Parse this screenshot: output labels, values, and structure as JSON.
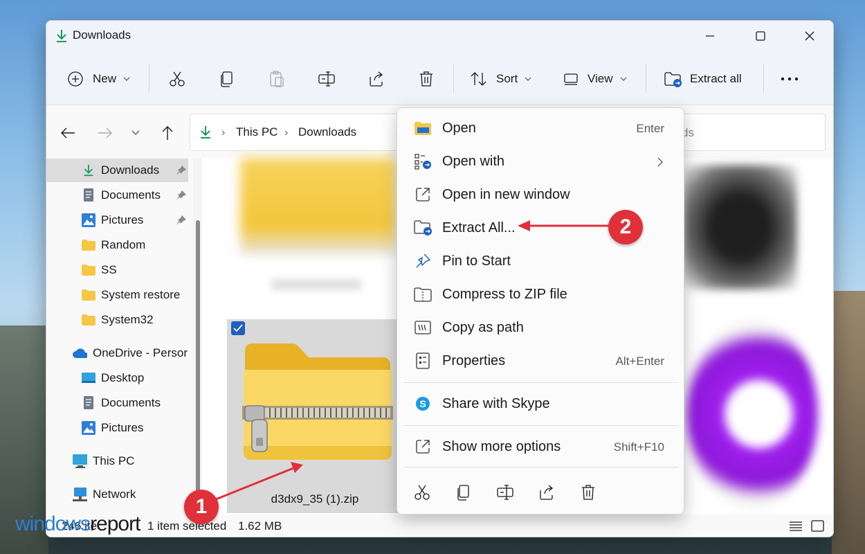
{
  "window": {
    "title": "Downloads"
  },
  "toolbar": {
    "new_label": "New",
    "sort_label": "Sort",
    "view_label": "View",
    "extract_label": "Extract all"
  },
  "address": {
    "crumbs": [
      "This PC",
      "Downloads"
    ],
    "search_placeholder": "ds"
  },
  "sidebar": {
    "items": [
      {
        "label": "Downloads",
        "icon": "download-icon",
        "pinned": true
      },
      {
        "label": "Documents",
        "icon": "document-icon",
        "pinned": true
      },
      {
        "label": "Pictures",
        "icon": "picture-icon",
        "pinned": true
      },
      {
        "label": "Random",
        "icon": "folder-icon",
        "pinned": false
      },
      {
        "label": "SS",
        "icon": "folder-icon",
        "pinned": false
      },
      {
        "label": "System restore",
        "icon": "folder-icon",
        "pinned": false
      },
      {
        "label": "System32",
        "icon": "folder-icon",
        "pinned": false
      },
      {
        "label": "OneDrive - Persor",
        "icon": "cloud-icon",
        "pinned": false
      },
      {
        "label": "Desktop",
        "icon": "desktop-icon",
        "pinned": false
      },
      {
        "label": "Documents",
        "icon": "document-icon",
        "pinned": false
      },
      {
        "label": "Pictures",
        "icon": "picture-icon",
        "pinned": false
      },
      {
        "label": "This PC",
        "icon": "computer-icon",
        "pinned": false
      },
      {
        "label": "Network",
        "icon": "network-icon",
        "pinned": false
      }
    ]
  },
  "content": {
    "selected_file": "d3dx9_35 (1).zip"
  },
  "status": {
    "count": "246 ite",
    "selected": "1 item selected",
    "size": "1.62 MB"
  },
  "context_menu": {
    "items": [
      {
        "label": "Open",
        "shortcut": "Enter",
        "icon": "folder-open-icon"
      },
      {
        "label": "Open with",
        "shortcut": "",
        "icon": "open-with-icon"
      },
      {
        "label": "Open in new window",
        "shortcut": "",
        "icon": "new-window-icon"
      },
      {
        "label": "Extract All...",
        "shortcut": "",
        "icon": "extract-icon"
      },
      {
        "label": "Pin to Start",
        "shortcut": "",
        "icon": "pin-icon"
      },
      {
        "label": "Compress to ZIP file",
        "shortcut": "",
        "icon": "zip-icon"
      },
      {
        "label": "Copy as path",
        "shortcut": "",
        "icon": "copy-path-icon"
      },
      {
        "label": "Properties",
        "shortcut": "Alt+Enter",
        "icon": "properties-icon"
      },
      {
        "label": "Share with Skype",
        "shortcut": "",
        "icon": "skype-icon"
      },
      {
        "label": "Show more options",
        "shortcut": "Shift+F10",
        "icon": "more-options-icon"
      }
    ],
    "action_icons": [
      "cut-icon",
      "copy-icon",
      "rename-icon",
      "share-icon",
      "delete-icon"
    ]
  },
  "annotations": {
    "step1": "1",
    "step2": "2"
  },
  "watermark": {
    "part1": "windows",
    "part2": "report"
  },
  "colors": {
    "accent": "#1f5fbf",
    "callout": "#e0303a",
    "download_green": "#1a9a5a",
    "folder_yellow": "#f6c744"
  }
}
